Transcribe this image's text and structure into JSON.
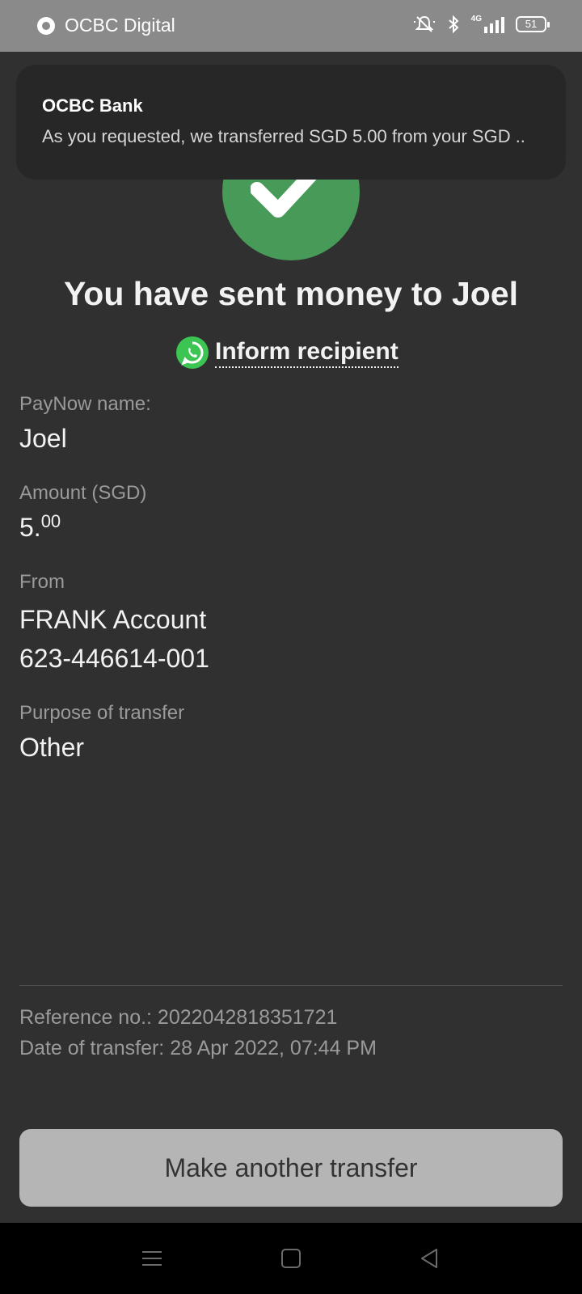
{
  "status_bar": {
    "app_name": "OCBC Digital",
    "network": "4G",
    "battery": "51",
    "icons": [
      "ocbc-logo-icon",
      "bell-off-icon",
      "bluetooth-icon",
      "signal-icon",
      "battery-icon"
    ]
  },
  "notification": {
    "title": "OCBC Bank",
    "body": "As you requested, we transferred SGD 5.00 from your SGD .."
  },
  "headline": "You have sent money to Joel",
  "inform": {
    "label": "Inform recipient",
    "icon": "whatsapp-icon"
  },
  "details": {
    "paynow_label": "PayNow name:",
    "paynow_value": "Joel",
    "amount_label": "Amount (SGD)",
    "amount_whole": "5.",
    "amount_cents": "00",
    "from_label": "From",
    "from_account_name": "FRANK Account",
    "from_account_number": "623-446614-001",
    "purpose_label": "Purpose of transfer",
    "purpose_value": "Other"
  },
  "meta": {
    "reference": "Reference no.: 2022042818351721",
    "date": "Date of transfer: 28 Apr 2022, 07:44 PM"
  },
  "cta_label": "Make another transfer",
  "colors": {
    "background": "#303030",
    "success": "#479a57",
    "whatsapp": "#3cc553",
    "button": "#b5b5b5"
  }
}
